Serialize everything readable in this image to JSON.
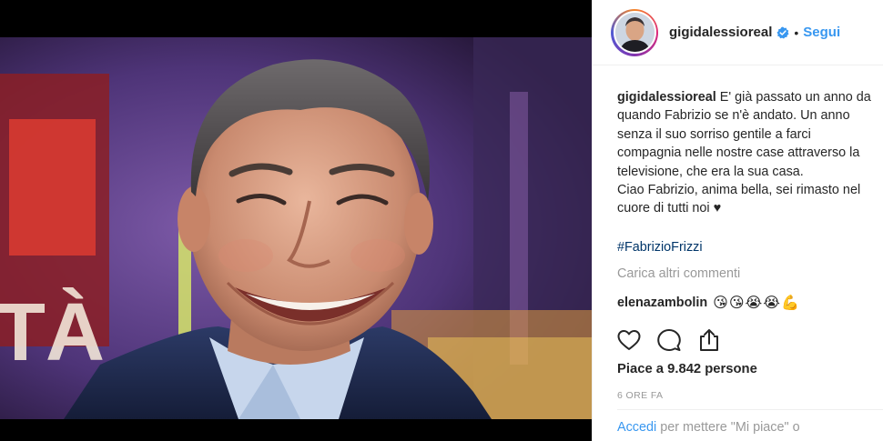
{
  "post": {
    "username": "gigidalessioreal",
    "follow_label": "Segui",
    "dot": "•",
    "caption": {
      "username": "gigidalessioreal",
      "lines": [
        "E' già passato un anno da",
        "quando Fabrizio se n'è andato. Un anno",
        "senza il suo sorriso gentile a farci",
        "compagnia nelle nostre case attraverso la",
        "televisione, che era la sua casa.",
        "Ciao Fabrizio, anima bella, sei rimasto nel",
        "cuore di tutti noi ♥"
      ],
      "hashtag": "#FabrizioFrizzi"
    },
    "more_comments": "Carica altri commenti",
    "comment": {
      "username": "elenazambolin",
      "emojis": [
        "😘",
        "😘",
        "😭",
        "😭",
        "💪"
      ]
    },
    "likes_text": "Piace a 9.842 persone",
    "timestamp": "6 ORE FA",
    "login": {
      "link": "Accedi",
      "rest": "per mettere \"Mi piace\" o"
    },
    "colors": {
      "link_blue": "#3897f0",
      "hashtag": "#003569",
      "muted": "#999999",
      "text": "#262626"
    },
    "icons": [
      "heart-icon",
      "comment-icon",
      "share-icon",
      "verified-badge-icon"
    ]
  }
}
